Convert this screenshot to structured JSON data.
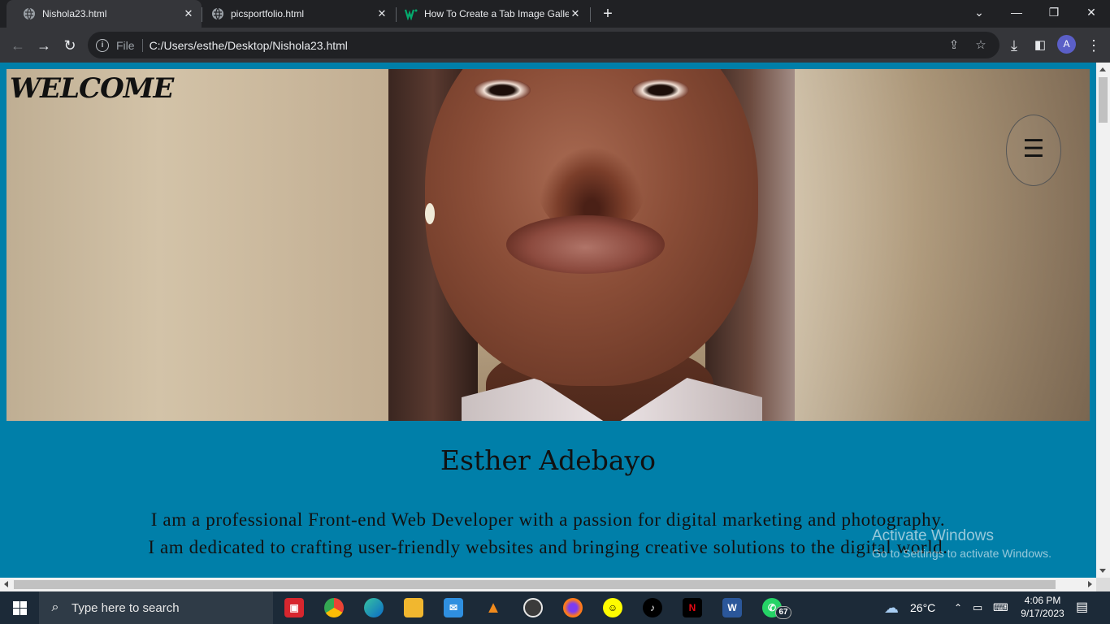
{
  "browser": {
    "tabs": [
      {
        "title": "Nishola23.html",
        "active": true
      },
      {
        "title": "picsportfolio.html",
        "active": false
      },
      {
        "title": "How To Create a Tab Image Galle",
        "active": false
      }
    ],
    "address": {
      "scheme": "File",
      "url": "C:/Users/esthe/Desktop/Nishola23.html"
    },
    "profile_initial": "A"
  },
  "page": {
    "welcome": "WELCOME",
    "menu_glyph": "☰",
    "name": "Esther Adebayo",
    "bio_line1": "I am a professional Front-end Web Developer with a passion for digital marketing and photography.",
    "bio_line2": "I am dedicated to crafting user-friendly websites and bringing creative solutions to the digital world.",
    "background_color": "#007fa9"
  },
  "watermark": {
    "line1": "Activate Windows",
    "line2": "Go to Settings to activate Windows."
  },
  "taskbar": {
    "search_placeholder": "Type here to search",
    "apps": [
      "xbox-game-bar",
      "chrome",
      "edge",
      "file-explorer",
      "mail",
      "vlc",
      "media-player",
      "firefox",
      "snapchat",
      "tiktok",
      "netflix",
      "word-app",
      "whatsapp"
    ],
    "whatsapp_badge": "67",
    "weather": "26°C",
    "time": "4:06 PM",
    "date": "9/17/2023"
  }
}
